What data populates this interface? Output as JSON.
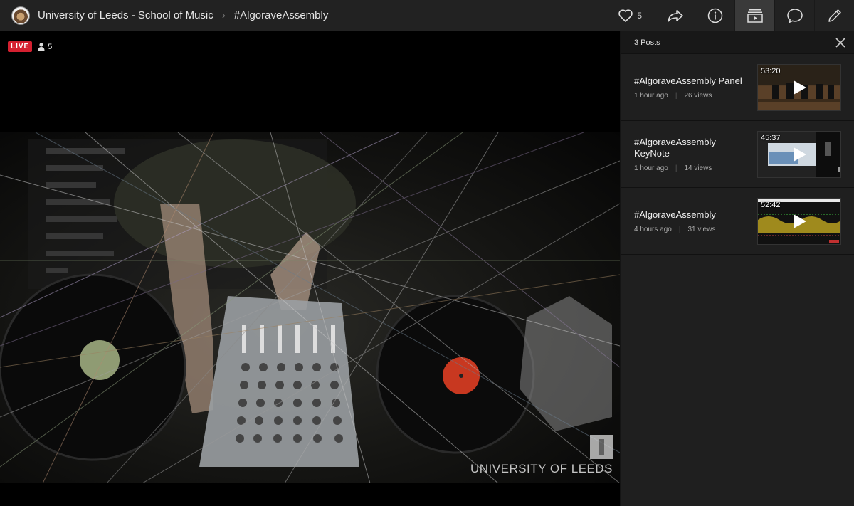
{
  "header": {
    "channel_name": "University of Leeds - School of Music",
    "event_name": "#AlgoraveAssembly",
    "likes_count": "5"
  },
  "player": {
    "live_label": "LIVE",
    "viewer_count": "5",
    "watermark_text": "UNIVERSITY OF LEEDS"
  },
  "sidebar": {
    "title": "3 Posts",
    "posts": [
      {
        "title": "#AlgoraveAssembly Panel",
        "time": "1 hour ago",
        "views": "26 views",
        "duration": "53:20"
      },
      {
        "title": "#AlgoraveAssembly KeyNote",
        "time": "1 hour ago",
        "views": "14 views",
        "duration": "45:37"
      },
      {
        "title": "#AlgoraveAssembly",
        "time": "4 hours ago",
        "views": "31 views",
        "duration": "52:42"
      }
    ]
  },
  "icons": [
    "heart-icon",
    "share-icon",
    "info-icon",
    "playlist-icon",
    "chat-icon",
    "pencil-icon",
    "close-icon",
    "person-icon",
    "play-icon"
  ],
  "colors": {
    "live": "#d42030",
    "topbar": "#222222",
    "sidebar": "#1f1f1f"
  }
}
